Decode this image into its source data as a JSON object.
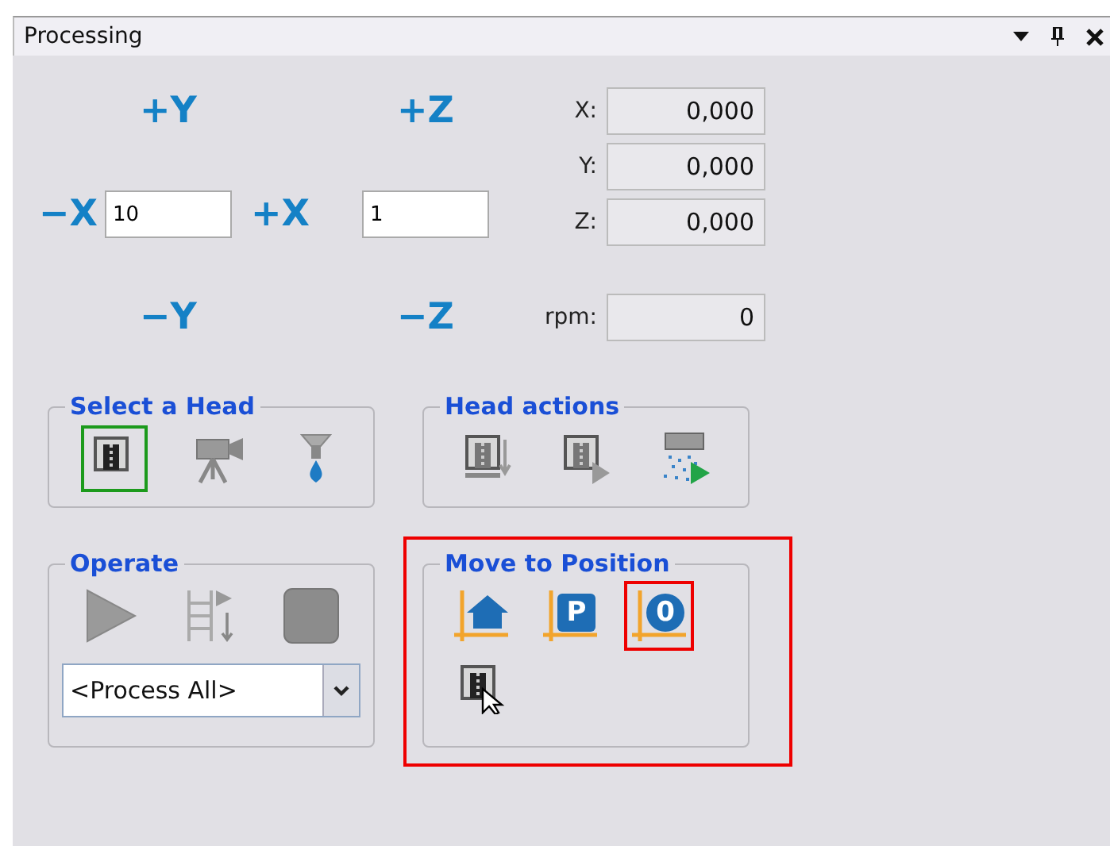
{
  "window": {
    "title": "Processing",
    "controls": [
      {
        "kind": "dropdown"
      },
      {
        "kind": "pin"
      },
      {
        "kind": "close"
      }
    ]
  },
  "jog": {
    "plus_y": "+Y",
    "plus_z": "+Z",
    "minus_x": "−X",
    "plus_x": "+X",
    "minus_y": "−Y",
    "minus_z": "−Z",
    "xy_step": "10",
    "z_step": "1"
  },
  "readouts": [
    {
      "label": "X:",
      "value": "0,000"
    },
    {
      "label": "Y:",
      "value": "0,000"
    },
    {
      "label": "Z:",
      "value": "0,000"
    },
    {
      "label": "rpm:",
      "value": "0"
    }
  ],
  "select_head": {
    "title": "Select a Head",
    "items": [
      {
        "kind": "spindle",
        "selected": true
      },
      {
        "kind": "camera",
        "selected": false
      },
      {
        "kind": "dispenser",
        "selected": false
      }
    ]
  },
  "head_actions": {
    "title": "Head actions",
    "items": [
      {
        "kind": "spindle-down"
      },
      {
        "kind": "spindle-run"
      },
      {
        "kind": "spray-run"
      }
    ]
  },
  "operate": {
    "title": "Operate",
    "items": [
      {
        "kind": "play"
      },
      {
        "kind": "step"
      },
      {
        "kind": "stop"
      }
    ],
    "dropdown": {
      "value": "<Process All>"
    }
  },
  "move_to_position": {
    "title": "Move to Position",
    "highlighted": true,
    "items": [
      {
        "kind": "home",
        "highlighted": false
      },
      {
        "kind": "park",
        "glyph": "P",
        "highlighted": false
      },
      {
        "kind": "zero",
        "glyph": "0",
        "highlighted": true
      },
      {
        "kind": "spindle-pointer",
        "highlighted": false
      }
    ]
  }
}
